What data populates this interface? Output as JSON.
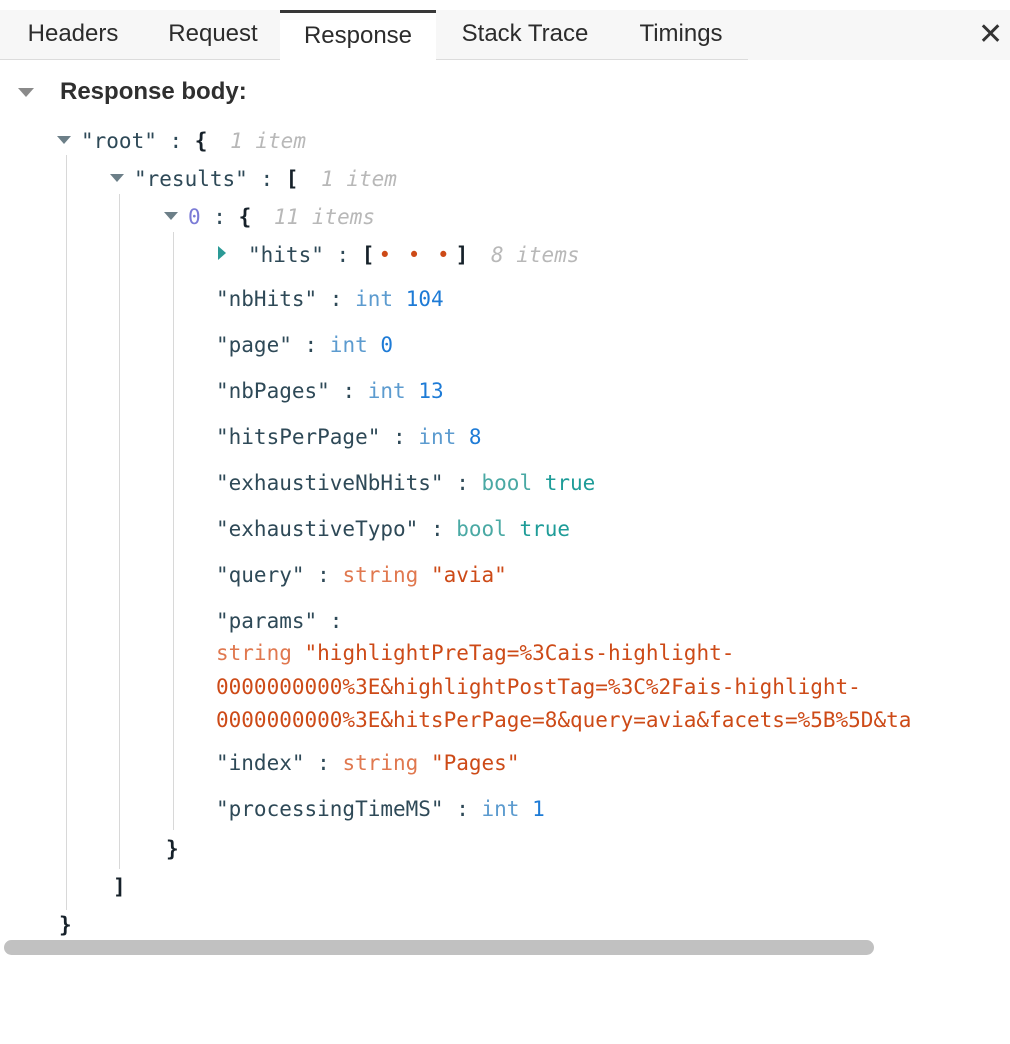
{
  "tabs": [
    {
      "label": "Headers",
      "active": false
    },
    {
      "label": "Request",
      "active": false
    },
    {
      "label": "Response",
      "active": true
    },
    {
      "label": "Stack Trace",
      "active": false
    },
    {
      "label": "Timings",
      "active": false
    }
  ],
  "close_glyph": "✕",
  "section_title": "Response body:",
  "tree": {
    "root_key": "\"root\"",
    "root_count": "1 item",
    "results_key": "\"results\"",
    "results_count": "1 item",
    "item0_index": "0",
    "item0_count": "11 items",
    "hits_key": "\"hits\"",
    "hits_collapsed": "• • •",
    "hits_count": "8 items",
    "fields": {
      "nbHits": {
        "key": "\"nbHits\"",
        "type": "int",
        "value": "104"
      },
      "page": {
        "key": "\"page\"",
        "type": "int",
        "value": "0"
      },
      "nbPages": {
        "key": "\"nbPages\"",
        "type": "int",
        "value": "13"
      },
      "hitsPerPage": {
        "key": "\"hitsPerPage\"",
        "type": "int",
        "value": "8"
      },
      "exhaustiveNbHits": {
        "key": "\"exhaustiveNbHits\"",
        "type": "bool",
        "value": "true"
      },
      "exhaustiveTypo": {
        "key": "\"exhaustiveTypo\"",
        "type": "bool",
        "value": "true"
      },
      "query": {
        "key": "\"query\"",
        "type": "string",
        "value": "\"avia\""
      },
      "params": {
        "key": "\"params\"",
        "type": "string",
        "line1": "\"highlightPreTag=%3Cais-highlight-",
        "line2": "0000000000%3E&highlightPostTag=%3C%2Fais-highlight-",
        "line3": "0000000000%3E&hitsPerPage=8&query=avia&facets=%5B%5D&ta"
      },
      "index": {
        "key": "\"index\"",
        "type": "string",
        "value": "\"Pages\""
      },
      "processingTimeMS": {
        "key": "\"processingTimeMS\"",
        "type": "int",
        "value": "1"
      }
    }
  },
  "colors": {
    "int_value": "#1e7bd6",
    "bool_value": "#1e9c98",
    "string_value": "#cd4a17",
    "index_label": "#7b7bd6"
  }
}
